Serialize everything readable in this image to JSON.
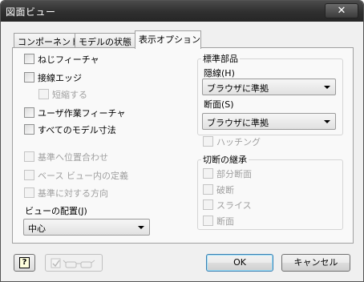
{
  "window": {
    "title": "図面ビュー",
    "close_glyph": "✕"
  },
  "tabs": [
    {
      "label": "コンポーネント",
      "active": false
    },
    {
      "label": "モデルの状態",
      "active": false
    },
    {
      "label": "表示オプション",
      "active": true
    }
  ],
  "left": {
    "thread_feature": "ねじフィーチャ",
    "tangent_edges": "接線エッジ",
    "foreshortened": "短縮する",
    "user_work_features": "ユーザ作業フィーチャ",
    "all_model_dims": "すべてのモデル寸法",
    "align_to_base": "基準へ位置合わせ",
    "defined_in_base": "ベース ビュー内の定義",
    "orientation_to_base": "基準に対する方向",
    "view_justification_label": "ビューの配置(J)",
    "view_justification_value": "中心"
  },
  "right": {
    "standard_parts_title": "標準部品",
    "hidden_label": "隠線(H)",
    "hidden_value": "ブラウザに準拠",
    "section_label": "断面(S)",
    "section_value": "ブラウザに準拠",
    "hatching": "ハッチング",
    "cut_inheritance_title": "切断の継承",
    "break_out": "部分断面",
    "break": "破断",
    "slice": "スライス",
    "section": "断面"
  },
  "footer": {
    "help_glyph": "?",
    "ok_label": "OK",
    "cancel_label": "キャンセル"
  }
}
